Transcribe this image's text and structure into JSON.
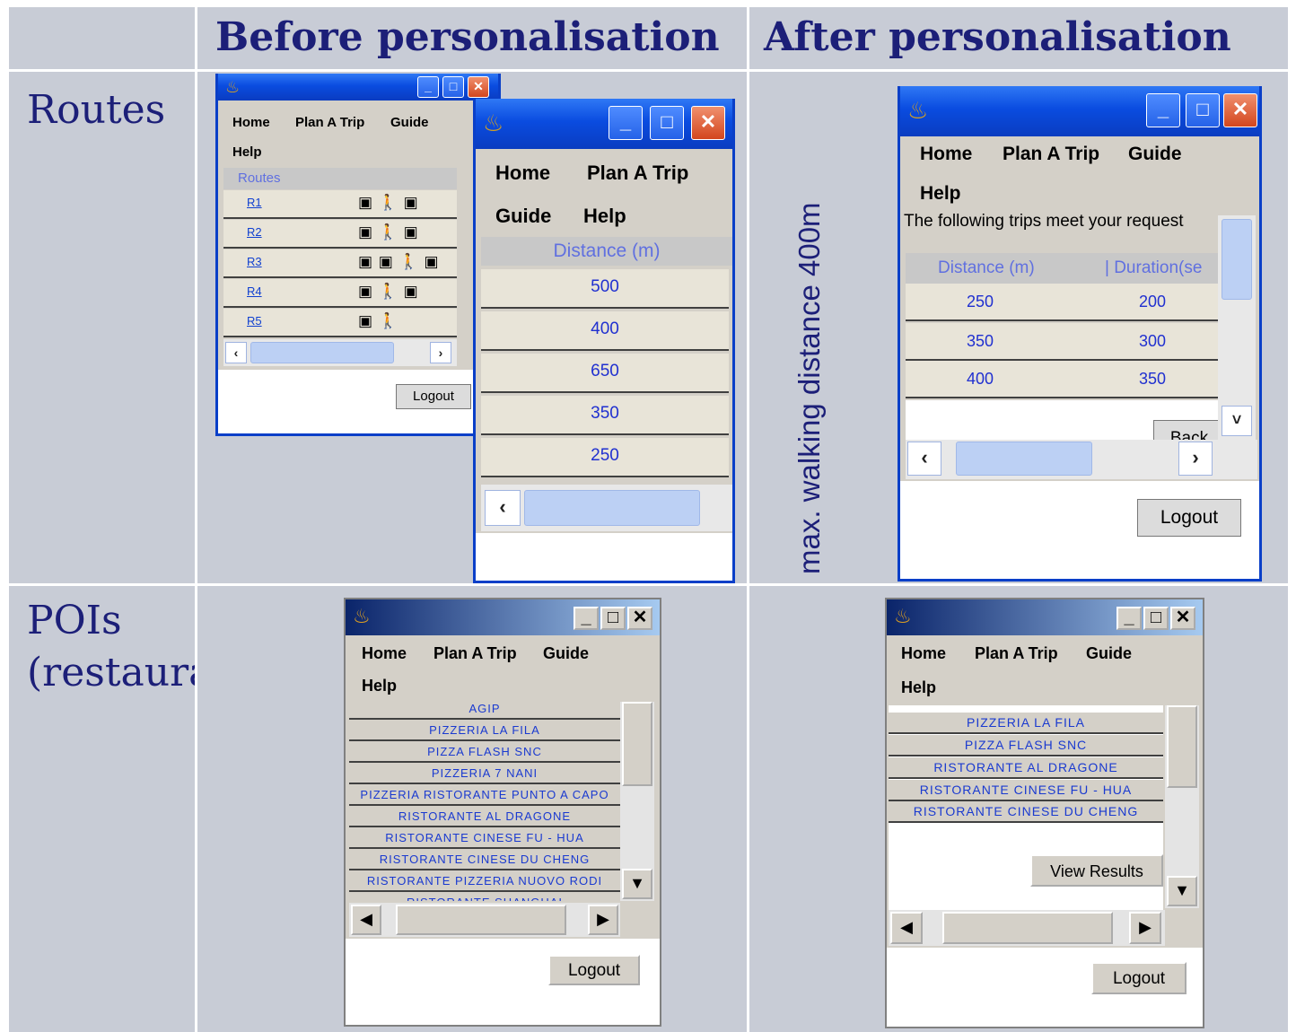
{
  "headers": {
    "before": "Before personalisation",
    "after": "After personalisation"
  },
  "row_labels": {
    "routes": "Routes",
    "pois": "POIs (restaurant)"
  },
  "constraint_label": "max. walking distance 400m",
  "menu": {
    "home": "Home",
    "plan": "Plan A Trip",
    "guide": "Guide",
    "help": "Help"
  },
  "routes_before": {
    "section_title": "Routes",
    "routes": [
      {
        "id": "R1",
        "modes": "▣ 🚶 ▣"
      },
      {
        "id": "R2",
        "modes": "▣ 🚶 ▣"
      },
      {
        "id": "R3",
        "modes": "▣ ▣ 🚶 ▣"
      },
      {
        "id": "R4",
        "modes": "▣ 🚶 ▣"
      },
      {
        "id": "R5",
        "modes": "▣ 🚶"
      }
    ],
    "logout": "Logout"
  },
  "distance_window": {
    "column": "Distance (m)",
    "values": [
      "500",
      "400",
      "650",
      "350",
      "250"
    ]
  },
  "routes_after": {
    "message": "The following trips meet your request",
    "columns": [
      "Distance (m)",
      "| Duration(se"
    ],
    "rows": [
      [
        "250",
        "200"
      ],
      [
        "350",
        "300"
      ],
      [
        "400",
        "350"
      ]
    ],
    "back": "Back",
    "logout": "Logout"
  },
  "pois_before": {
    "items": [
      "AGIP",
      "PIZZERIA LA FILA",
      "PIZZA FLASH SNC",
      "PIZZERIA 7 NANI",
      "PIZZERIA RISTORANTE PUNTO A CAPO",
      "RISTORANTE AL DRAGONE",
      "RISTORANTE CINESE FU - HUA",
      "RISTORANTE CINESE DU CHENG",
      "RISTORANTE PIZZERIA NUOVO RODI",
      "RISTORANTE SHANGHAI"
    ],
    "logout": "Logout"
  },
  "pois_after": {
    "items": [
      "PIZZERIA LA FILA",
      "PIZZA FLASH SNC",
      "RISTORANTE AL DRAGONE",
      "RISTORANTE CINESE FU - HUA",
      "RISTORANTE CINESE DU CHENG"
    ],
    "view_results": "View Results",
    "logout": "Logout"
  }
}
